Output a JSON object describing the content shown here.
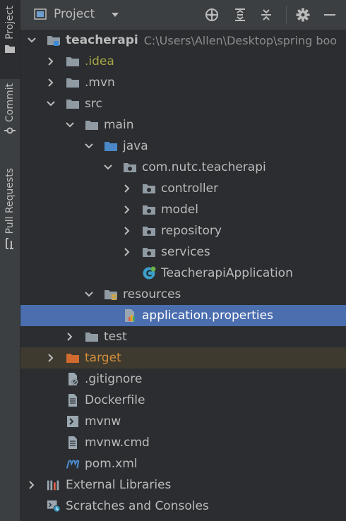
{
  "sidebar": {
    "project": "Project",
    "commit": "Commit",
    "pull_requests": "Pull Requests"
  },
  "header": {
    "title": "Project"
  },
  "tree": {
    "root": {
      "name": "teacherapi",
      "path": "C:\\Users\\Allen\\Desktop\\spring boo"
    },
    "idea": ".idea",
    "mvn": ".mvn",
    "src": "src",
    "main": "main",
    "java": "java",
    "package": "com.nutc.teacherapi",
    "controller": "controller",
    "model": "model",
    "repository": "repository",
    "services": "services",
    "app_class": "TeacherapiApplication",
    "resources": "resources",
    "app_props": "application.properties",
    "test": "test",
    "target": "target",
    "gitignore": ".gitignore",
    "dockerfile": "Dockerfile",
    "mvnw": "mvnw",
    "mvnw_cmd": "mvnw.cmd",
    "pom": "pom.xml",
    "ext_libs": "External Libraries",
    "scratches": "Scratches and Consoles"
  },
  "colors": {
    "selection": "#4b6eaf",
    "folder": "#8f9aa3",
    "source_folder": "#4a88c7",
    "excluded_folder": "#d06a2e",
    "class_icon": "#3d9ec7"
  }
}
